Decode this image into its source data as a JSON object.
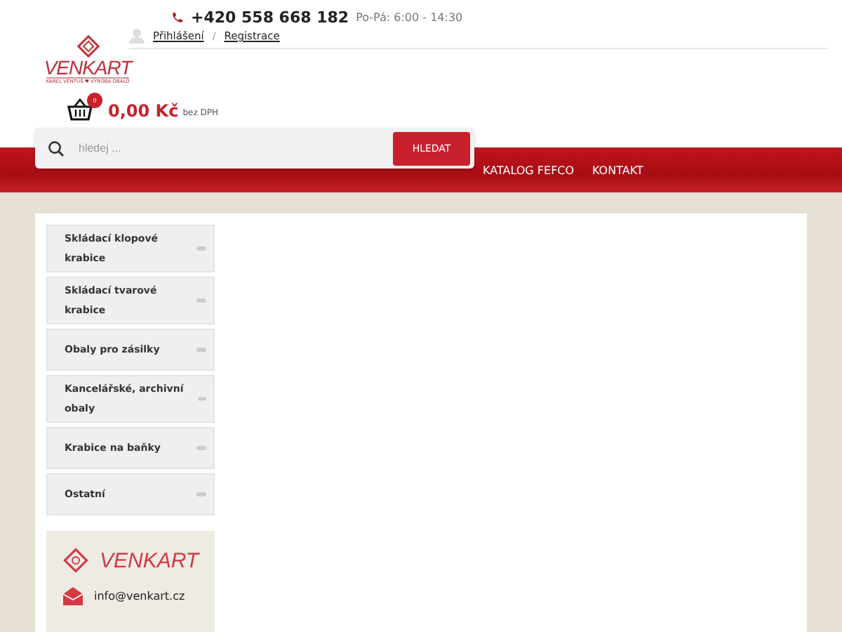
{
  "header": {
    "logo": {
      "name": "VENKART",
      "tagline": "KAREL VĚNTUŠ ♥ VÝROBA OBALŮ"
    },
    "phone": "+420 558 668 182",
    "hours": "Po-Pá: 6:00 - 14:30",
    "login": "Přihlášení",
    "separator": "/",
    "register": "Registrace"
  },
  "cart": {
    "badge": "0",
    "price": "0,00 Kč",
    "note": "bez DPH"
  },
  "search": {
    "placeholder": "hledej ...",
    "button": "HLEDAT"
  },
  "nav": [
    {
      "label": "KATALOG FEFCO"
    },
    {
      "label": "KONTAKT"
    }
  ],
  "sidebar": {
    "items": [
      {
        "label": "Skládací klopové krabice"
      },
      {
        "label": "Skládací tvarové krabice"
      },
      {
        "label": "Obaly pro zásilky"
      },
      {
        "label": "Kancelářské, archivní obaly"
      },
      {
        "label": "Krabice na baňky"
      },
      {
        "label": "Ostatní"
      }
    ]
  },
  "contact": {
    "logo": "VENKART",
    "email": "info@venkart.cz"
  }
}
